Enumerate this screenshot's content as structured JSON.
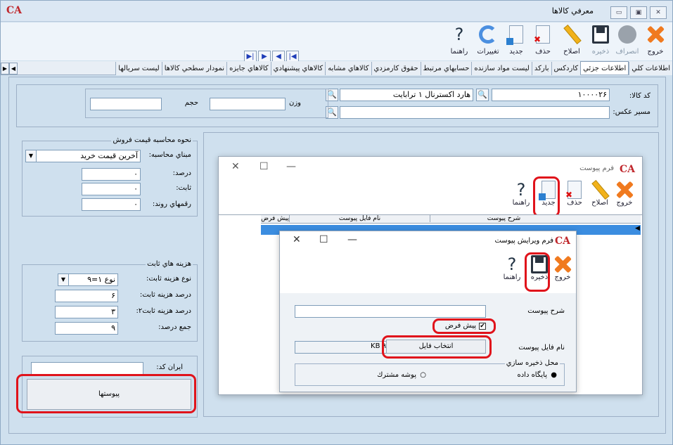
{
  "window": {
    "title": "معرفي كالاها",
    "logo": "CA"
  },
  "toolbar": {
    "exit": "خروج",
    "cancel": "انصراف",
    "save": "ذخيره",
    "edit": "اصلاح",
    "delete": "حذف",
    "new": "جديد",
    "changes": "تغييرات",
    "help": "راهنما"
  },
  "tabs": [
    "اطلاعات كلي",
    "اطلاعات جزئي",
    "كاردكس",
    "باركد",
    "ليست مواد سازنده",
    "حسابهاي مرتبط",
    "حقوق كارمزدي",
    "كالاهاي مشابه",
    "كالاهاي پيشنهادي",
    "كالاهاي جايزه",
    "نمودار سطحي كالاها",
    "ليست سريالها"
  ],
  "header": {
    "code_label": "كد كالا:",
    "code_value": "۱۰۰۰۰۲۶",
    "name_value": "هارد اكسترنال ۱ ترابايت",
    "image_path_label": "مسير عكس:",
    "weight_label": "وزن",
    "volume_label": "حجم"
  },
  "pricing": {
    "title": "نحوه محاسبه قيمت فروش",
    "basis_label": "مبناي محاسبه:",
    "basis_value": "آخرين قيمت خريد",
    "percent_label": "درصد:",
    "percent_value": "۰",
    "fixed_label": "ثابت:",
    "fixed_value": "۰",
    "round_label": "رقمهاي روند:",
    "round_value": "۰"
  },
  "fixed_costs": {
    "title": "هزينه هاي ثابت",
    "type_label": "نوع هزينه ثابت:",
    "type_value": "نوع ۱=۹",
    "pct_label": "درصد هزينه ثابت:",
    "pct_value": "۶",
    "pct2_label": "درصد هزينه ثابت۲:",
    "pct2_value": "۳",
    "sum_label": "جمع درصد:",
    "sum_value": "۹"
  },
  "iran_code_label": "ايران كد:",
  "attachments_button": "پيوستها",
  "attach_form": {
    "title": "فرم پيوست",
    "exit": "خروج",
    "edit": "اصلاح",
    "delete": "حذف",
    "new": "جديد",
    "help": "راهنما",
    "col_desc": "شرح پيوست",
    "col_file": "نام فايل پيوست",
    "col_default": "پيش فرض"
  },
  "edit_form": {
    "title": "فرم ويرايش پيوست",
    "exit": "خروج",
    "save": "ذخيره",
    "help": "راهنما",
    "desc_label": "شرح پيوست",
    "default_label": "پيش فرض",
    "file_label": "نام فايل پيوست",
    "file_size": "KB ۹",
    "choose_file": "انتخاب فايل",
    "storage_title": "محل ذخيره سازي",
    "db_option": "پايگاه داده",
    "shared_option": "پوشه مشترك"
  }
}
